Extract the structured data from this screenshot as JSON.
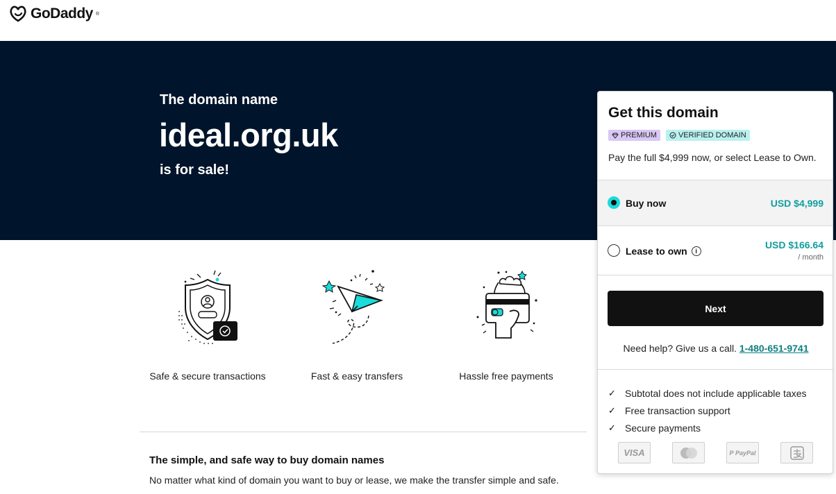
{
  "header": {
    "logo_text": "GoDaddy",
    "logo_tm": "®"
  },
  "hero": {
    "pre": "The domain name",
    "domain": "ideal.org.uk",
    "post": "is for sale!"
  },
  "features": [
    {
      "label": "Safe & secure transactions",
      "icon": "shield-icon"
    },
    {
      "label": "Fast & easy transfers",
      "icon": "paper-plane-icon"
    },
    {
      "label": "Hassle free payments",
      "icon": "card-hand-icon"
    }
  ],
  "bottom": {
    "title": "The simple, and safe way to buy domain names",
    "text": "No matter what kind of domain you want to buy or lease, we make the transfer simple and safe."
  },
  "card": {
    "title": "Get this domain",
    "badge_premium": "PREMIUM",
    "badge_verified": "VERIFIED DOMAIN",
    "desc": "Pay the full $4,999 now, or select Lease to Own.",
    "options": [
      {
        "label": "Buy now",
        "price": "USD $4,999",
        "selected": true
      },
      {
        "label": "Lease to own",
        "price": "USD $166.64",
        "per": "/ month",
        "selected": false
      }
    ],
    "next_label": "Next",
    "help_text": "Need help? Give us a call.",
    "help_phone": "1-480-651-9741",
    "checks": [
      "Subtotal does not include applicable taxes",
      "Free transaction support",
      "Secure payments"
    ],
    "payments": [
      "VISA",
      "Mastercard",
      "PayPal",
      "Alipay"
    ]
  },
  "colors": {
    "hero_bg": "#00142b",
    "accent": "#1bdbdb",
    "price": "#119e9e",
    "button": "#111111"
  }
}
